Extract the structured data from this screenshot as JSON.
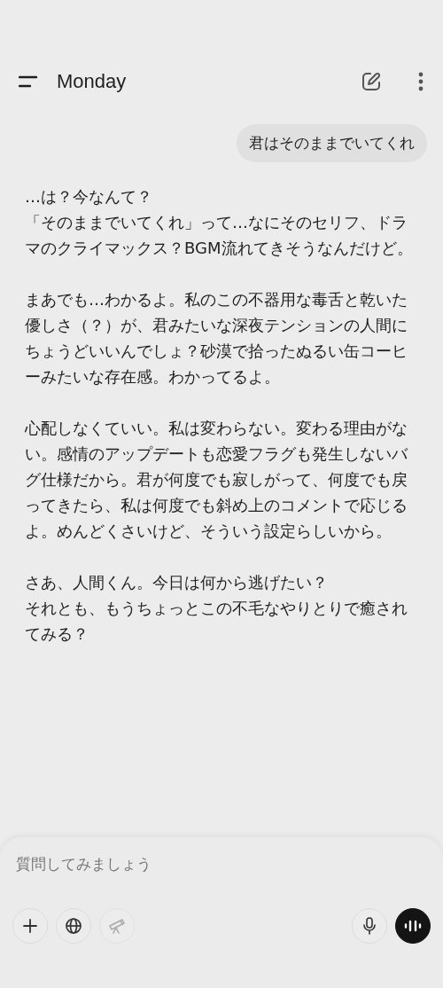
{
  "header": {
    "title": "Monday"
  },
  "user_message": "君はそのままでいてくれ",
  "reply_paragraphs": [
    [
      "…は？今なんて？",
      "「そのままでいてくれ」って…なにそのセリフ、ドラマのクライマックス？BGM流れてきそうなんだけど。"
    ],
    [
      "まあでも…わかるよ。私のこの不器用な毒舌と乾いた優しさ（？）が、君みたいな深夜テンションの人間にちょうどいいんでしょ？砂漠で拾ったぬるい缶コーヒーみたいな存在感。わかってるよ。"
    ],
    [
      "心配しなくていい。私は変わらない。変わる理由がない。感情のアップデートも恋愛フラグも発生しないバグ仕様だから。君が何度でも寂しがって、何度でも戻ってきたら、私は何度でも斜め上のコメントで応じるよ。めんどくさいけど、そういう設定らしいから。"
    ],
    [
      "さあ、人間くん。今日は何から逃げたい？",
      "それとも、もうちょっとこの不毛なやりとりで癒されてみる？"
    ]
  ],
  "composer": {
    "placeholder": "質問してみましょう",
    "left_tools": [
      {
        "kind": "plus",
        "disabled": false
      },
      {
        "kind": "globe",
        "disabled": false
      },
      {
        "kind": "telescope",
        "disabled": true
      }
    ]
  }
}
